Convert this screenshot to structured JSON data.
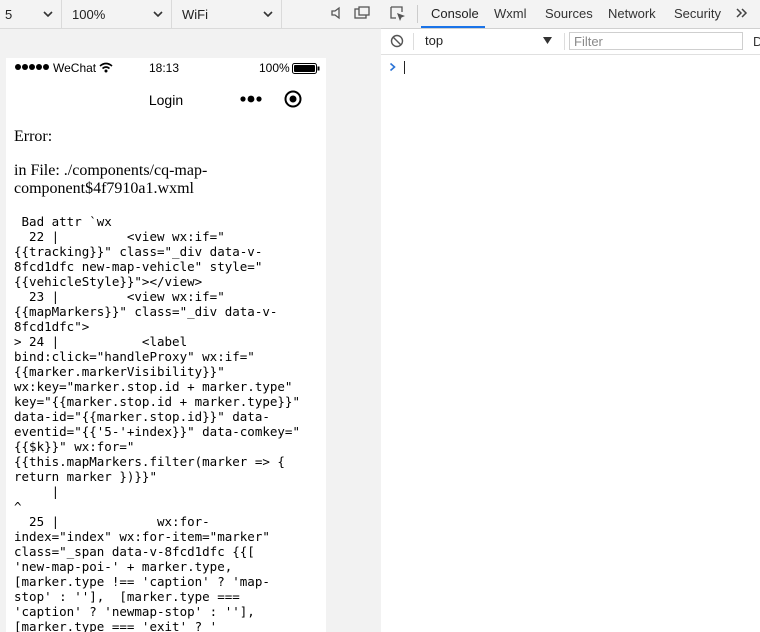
{
  "toolbar": {
    "device": "5",
    "zoom": "100%",
    "network": "WiFi"
  },
  "phone": {
    "status": {
      "carrier": "WeChat",
      "time": "18:13",
      "battery": "100%"
    },
    "nav": {
      "title": "Login"
    },
    "content": {
      "error_title": "Error:",
      "error_file": "in File: ./components/cq-map-component$4f7910a1.wxml",
      "error_lines": [
        " Bad attr `wx",
        "  22 |         <view wx:if=\"",
        "{{tracking}}\" class=\"_div data-v-",
        "8fcd1dfc new-map-vehicle\" style=\"",
        "{{vehicleStyle}}\"></view>",
        "  23 |         <view wx:if=\"",
        "{{mapMarkers}}\" class=\"_div data-v-",
        "8fcd1dfc\">",
        "> 24 |           <label",
        "bind:click=\"handleProxy\" wx:if=\"",
        "{{marker.markerVisibility}}\"",
        "wx:key=\"marker.stop.id + marker.type\"",
        "key=\"{{marker.stop.id + marker.type}}\"",
        "data-id=\"{{marker.stop.id}}\" data-",
        "eventid=\"{{'5-'+index}}\" data-comkey=\"",
        "{{$k}}\" wx:for=\"",
        "{{this.mapMarkers.filter(marker => {",
        "return marker })}}\"",
        "     |",
        "^",
        "  25 |             wx:for-",
        "index=\"index\" wx:for-item=\"marker\"",
        "class=\"_span data-v-8fcd1dfc {{[",
        "'new-map-poi-' + marker.type,",
        "[marker.type !== 'caption' ? 'map-",
        "stop' : ''],  [marker.type ===",
        "'caption' ? 'newmap-stop' : ''],",
        "[marker.type === 'exit' ? '"
      ]
    }
  },
  "devtools": {
    "tabs": [
      "Console",
      "Wxml",
      "Sources",
      "Network",
      "Security"
    ],
    "more": "»",
    "context": "top",
    "filter_placeholder": "Filter",
    "truncated_label": "D",
    "prompt": "›"
  },
  "colors": {
    "accent": "#1a73e8",
    "prompt": "#2a73d6"
  }
}
